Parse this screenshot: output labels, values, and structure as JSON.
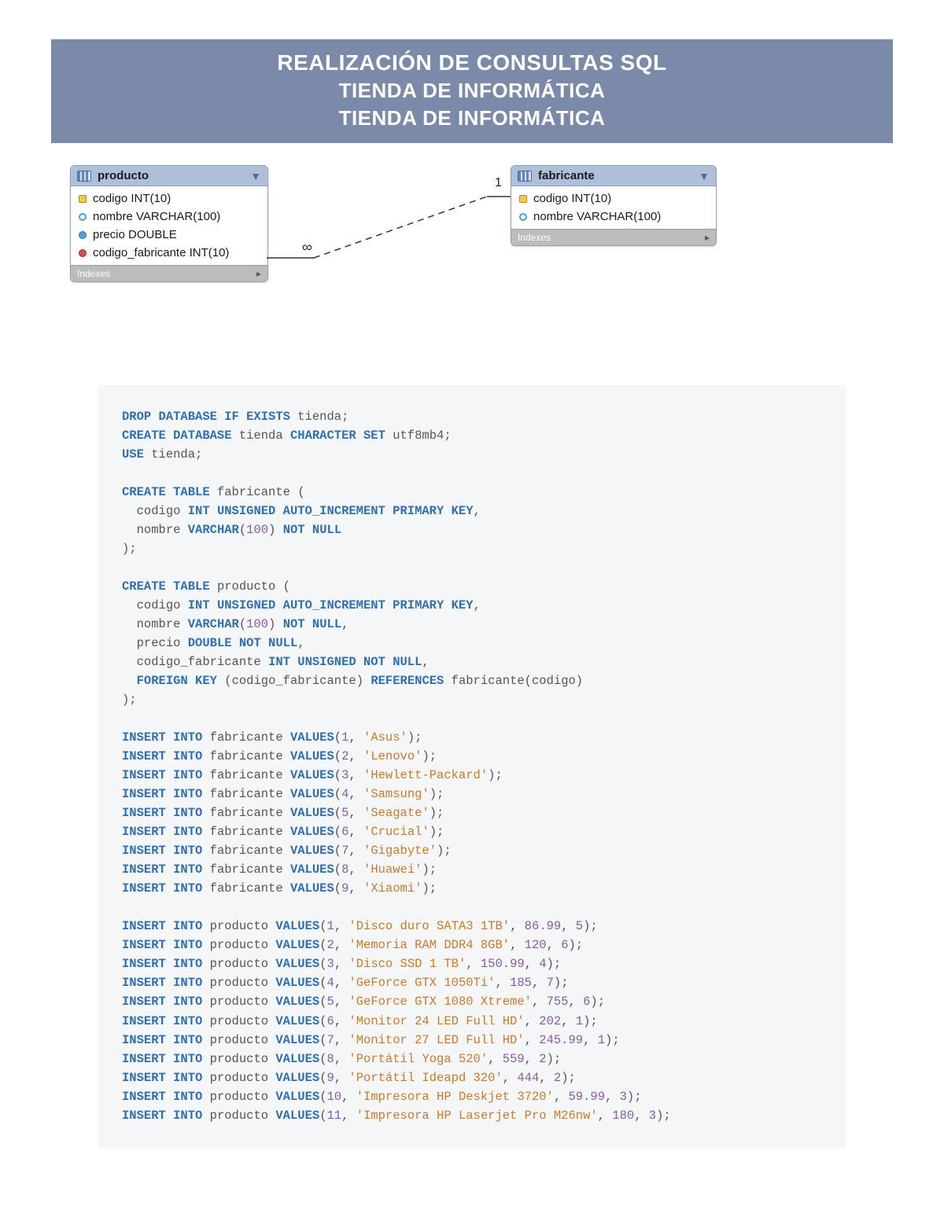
{
  "banner": {
    "line1": "REALIZACIÓN DE CONSULTAS SQL",
    "line2": "TIENDA DE INFORMÁTICA",
    "line3": "TIENDA DE INFORMÁTICA"
  },
  "erd": {
    "producto": {
      "title": "producto",
      "columns": [
        {
          "icon": "key",
          "text": "codigo INT(10)"
        },
        {
          "icon": "blue",
          "text": "nombre VARCHAR(100)"
        },
        {
          "icon": "solidblue",
          "text": "precio DOUBLE"
        },
        {
          "icon": "red",
          "text": "codigo_fabricante INT(10)"
        }
      ],
      "footer": "Indexes"
    },
    "fabricante": {
      "title": "fabricante",
      "columns": [
        {
          "icon": "key",
          "text": "codigo INT(10)"
        },
        {
          "icon": "blue",
          "text": "nombre VARCHAR(100)"
        }
      ],
      "footer": "Indexes"
    },
    "card_one": "1",
    "card_many": "∞"
  },
  "sql": {
    "drop": {
      "kw1": "DROP DATABASE IF EXISTS",
      "db": "tienda",
      "semi": ";"
    },
    "create_db": {
      "kw1": "CREATE DATABASE",
      "db": "tienda",
      "kw2": "CHARACTER SET",
      "cs": "utf8mb4",
      "semi": ";"
    },
    "use": {
      "kw1": "USE",
      "db": "tienda",
      "semi": ";"
    },
    "ct_fab_open": {
      "kw": "CREATE TABLE",
      "name": "fabricante",
      "open": " ("
    },
    "ct_fab_l1": "  codigo INT UNSIGNED AUTO_INCREMENT PRIMARY KEY,",
    "ct_fab_l1_id": "codigo",
    "ct_fab_l1_kw": "INT UNSIGNED AUTO_INCREMENT PRIMARY KEY",
    "ct_fab_l2_id": "nombre",
    "ct_fab_l2_kw1": "VARCHAR",
    "ct_fab_l2_num": "100",
    "ct_fab_l2_kw2": "NOT NULL",
    "close_paren": ");",
    "ct_prod_open": {
      "kw": "CREATE TABLE",
      "name": "producto",
      "open": " ("
    },
    "ct_prod_l1_id": "codigo",
    "ct_prod_l1_kw": "INT UNSIGNED AUTO_INCREMENT PRIMARY KEY",
    "ct_prod_l2_id": "nombre",
    "ct_prod_l2_kw1": "VARCHAR",
    "ct_prod_l2_num": "100",
    "ct_prod_l2_kw2": "NOT NULL",
    "ct_prod_l3_id": "precio",
    "ct_prod_l3_kw": "DOUBLE NOT NULL",
    "ct_prod_l4_id": "codigo_fabricante",
    "ct_prod_l4_kw": "INT UNSIGNED NOT NULL",
    "ct_prod_l5_kw1": "FOREIGN KEY",
    "ct_prod_l5_col": "codigo_fabricante",
    "ct_prod_l5_kw2": "REFERENCES",
    "ct_prod_l5_ref": "fabricante",
    "ct_prod_l5_refcol": "codigo",
    "ins_kw": "INSERT INTO",
    "vals_kw": "VALUES",
    "fabricantes": [
      {
        "n": "1",
        "s": "'Asus'"
      },
      {
        "n": "2",
        "s": "'Lenovo'"
      },
      {
        "n": "3",
        "s": "'Hewlett-Packard'"
      },
      {
        "n": "4",
        "s": "'Samsung'"
      },
      {
        "n": "5",
        "s": "'Seagate'"
      },
      {
        "n": "6",
        "s": "'Crucial'"
      },
      {
        "n": "7",
        "s": "'Gigabyte'"
      },
      {
        "n": "8",
        "s": "'Huawei'"
      },
      {
        "n": "9",
        "s": "'Xiaomi'"
      }
    ],
    "productos": [
      {
        "n": "1",
        "s": "'Disco duro SATA3 1TB'",
        "p": "86.99",
        "f": "5"
      },
      {
        "n": "2",
        "s": "'Memoria RAM DDR4 8GB'",
        "p": "120",
        "f": "6"
      },
      {
        "n": "3",
        "s": "'Disco SSD 1 TB'",
        "p": "150.99",
        "f": "4"
      },
      {
        "n": "4",
        "s": "'GeForce GTX 1050Ti'",
        "p": "185",
        "f": "7"
      },
      {
        "n": "5",
        "s": "'GeForce GTX 1080 Xtreme'",
        "p": "755",
        "f": "6"
      },
      {
        "n": "6",
        "s": "'Monitor 24 LED Full HD'",
        "p": "202",
        "f": "1"
      },
      {
        "n": "7",
        "s": "'Monitor 27 LED Full HD'",
        "p": "245.99",
        "f": "1"
      },
      {
        "n": "8",
        "s": "'Portátil Yoga 520'",
        "p": "559",
        "f": "2"
      },
      {
        "n": "9",
        "s": "'Portátil Ideapd 320'",
        "p": "444",
        "f": "2"
      },
      {
        "n": "10",
        "s": "'Impresora HP Deskjet 3720'",
        "p": "59.99",
        "f": "3"
      },
      {
        "n": "11",
        "s": "'Impresora HP Laserjet Pro M26nw'",
        "p": "180",
        "f": "3"
      }
    ],
    "tbl_fab": "fabricante",
    "tbl_prod": "producto"
  }
}
